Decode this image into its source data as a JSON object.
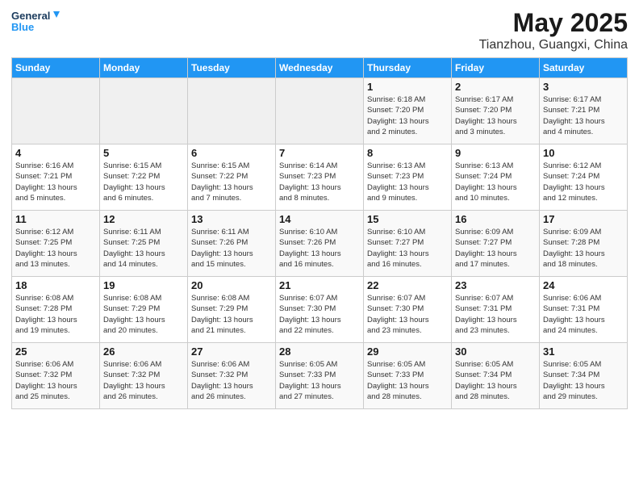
{
  "header": {
    "logo_line1": "General",
    "logo_line2": "Blue",
    "title": "May 2025",
    "subtitle": "Tianzhou, Guangxi, China"
  },
  "weekdays": [
    "Sunday",
    "Monday",
    "Tuesday",
    "Wednesday",
    "Thursday",
    "Friday",
    "Saturday"
  ],
  "weeks": [
    [
      {
        "day": "",
        "info": ""
      },
      {
        "day": "",
        "info": ""
      },
      {
        "day": "",
        "info": ""
      },
      {
        "day": "",
        "info": ""
      },
      {
        "day": "1",
        "info": "Sunrise: 6:18 AM\nSunset: 7:20 PM\nDaylight: 13 hours\nand 2 minutes."
      },
      {
        "day": "2",
        "info": "Sunrise: 6:17 AM\nSunset: 7:20 PM\nDaylight: 13 hours\nand 3 minutes."
      },
      {
        "day": "3",
        "info": "Sunrise: 6:17 AM\nSunset: 7:21 PM\nDaylight: 13 hours\nand 4 minutes."
      }
    ],
    [
      {
        "day": "4",
        "info": "Sunrise: 6:16 AM\nSunset: 7:21 PM\nDaylight: 13 hours\nand 5 minutes."
      },
      {
        "day": "5",
        "info": "Sunrise: 6:15 AM\nSunset: 7:22 PM\nDaylight: 13 hours\nand 6 minutes."
      },
      {
        "day": "6",
        "info": "Sunrise: 6:15 AM\nSunset: 7:22 PM\nDaylight: 13 hours\nand 7 minutes."
      },
      {
        "day": "7",
        "info": "Sunrise: 6:14 AM\nSunset: 7:23 PM\nDaylight: 13 hours\nand 8 minutes."
      },
      {
        "day": "8",
        "info": "Sunrise: 6:13 AM\nSunset: 7:23 PM\nDaylight: 13 hours\nand 9 minutes."
      },
      {
        "day": "9",
        "info": "Sunrise: 6:13 AM\nSunset: 7:24 PM\nDaylight: 13 hours\nand 10 minutes."
      },
      {
        "day": "10",
        "info": "Sunrise: 6:12 AM\nSunset: 7:24 PM\nDaylight: 13 hours\nand 12 minutes."
      }
    ],
    [
      {
        "day": "11",
        "info": "Sunrise: 6:12 AM\nSunset: 7:25 PM\nDaylight: 13 hours\nand 13 minutes."
      },
      {
        "day": "12",
        "info": "Sunrise: 6:11 AM\nSunset: 7:25 PM\nDaylight: 13 hours\nand 14 minutes."
      },
      {
        "day": "13",
        "info": "Sunrise: 6:11 AM\nSunset: 7:26 PM\nDaylight: 13 hours\nand 15 minutes."
      },
      {
        "day": "14",
        "info": "Sunrise: 6:10 AM\nSunset: 7:26 PM\nDaylight: 13 hours\nand 16 minutes."
      },
      {
        "day": "15",
        "info": "Sunrise: 6:10 AM\nSunset: 7:27 PM\nDaylight: 13 hours\nand 16 minutes."
      },
      {
        "day": "16",
        "info": "Sunrise: 6:09 AM\nSunset: 7:27 PM\nDaylight: 13 hours\nand 17 minutes."
      },
      {
        "day": "17",
        "info": "Sunrise: 6:09 AM\nSunset: 7:28 PM\nDaylight: 13 hours\nand 18 minutes."
      }
    ],
    [
      {
        "day": "18",
        "info": "Sunrise: 6:08 AM\nSunset: 7:28 PM\nDaylight: 13 hours\nand 19 minutes."
      },
      {
        "day": "19",
        "info": "Sunrise: 6:08 AM\nSunset: 7:29 PM\nDaylight: 13 hours\nand 20 minutes."
      },
      {
        "day": "20",
        "info": "Sunrise: 6:08 AM\nSunset: 7:29 PM\nDaylight: 13 hours\nand 21 minutes."
      },
      {
        "day": "21",
        "info": "Sunrise: 6:07 AM\nSunset: 7:30 PM\nDaylight: 13 hours\nand 22 minutes."
      },
      {
        "day": "22",
        "info": "Sunrise: 6:07 AM\nSunset: 7:30 PM\nDaylight: 13 hours\nand 23 minutes."
      },
      {
        "day": "23",
        "info": "Sunrise: 6:07 AM\nSunset: 7:31 PM\nDaylight: 13 hours\nand 23 minutes."
      },
      {
        "day": "24",
        "info": "Sunrise: 6:06 AM\nSunset: 7:31 PM\nDaylight: 13 hours\nand 24 minutes."
      }
    ],
    [
      {
        "day": "25",
        "info": "Sunrise: 6:06 AM\nSunset: 7:32 PM\nDaylight: 13 hours\nand 25 minutes."
      },
      {
        "day": "26",
        "info": "Sunrise: 6:06 AM\nSunset: 7:32 PM\nDaylight: 13 hours\nand 26 minutes."
      },
      {
        "day": "27",
        "info": "Sunrise: 6:06 AM\nSunset: 7:32 PM\nDaylight: 13 hours\nand 26 minutes."
      },
      {
        "day": "28",
        "info": "Sunrise: 6:05 AM\nSunset: 7:33 PM\nDaylight: 13 hours\nand 27 minutes."
      },
      {
        "day": "29",
        "info": "Sunrise: 6:05 AM\nSunset: 7:33 PM\nDaylight: 13 hours\nand 28 minutes."
      },
      {
        "day": "30",
        "info": "Sunrise: 6:05 AM\nSunset: 7:34 PM\nDaylight: 13 hours\nand 28 minutes."
      },
      {
        "day": "31",
        "info": "Sunrise: 6:05 AM\nSunset: 7:34 PM\nDaylight: 13 hours\nand 29 minutes."
      }
    ]
  ]
}
